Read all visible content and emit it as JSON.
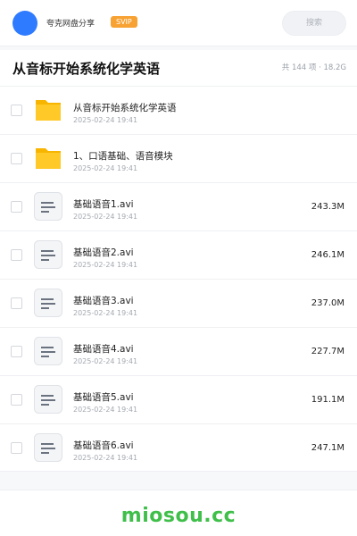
{
  "header": {
    "brand": "夸克网盘分享",
    "badge": "SVIP",
    "search_placeholder": "搜索",
    "accent": "#2f7bff"
  },
  "folder": {
    "title": "从音标开始系统化学英语",
    "meta": "共 144 项 · 18.2G"
  },
  "files": [
    {
      "icon": "folder-icon",
      "name": "从音标开始系统化学英语",
      "date": "2025-02-24 19:41",
      "size": ""
    },
    {
      "icon": "folder-icon",
      "name": "1、口语基础、语音模块",
      "date": "2025-02-24 19:41",
      "size": ""
    },
    {
      "icon": "file-icon",
      "name": "基础语音1.avi",
      "date": "2025-02-24 19:41",
      "size": "243.3M"
    },
    {
      "icon": "file-icon",
      "name": "基础语音2.avi",
      "date": "2025-02-24 19:41",
      "size": "246.1M"
    },
    {
      "icon": "file-icon",
      "name": "基础语音3.avi",
      "date": "2025-02-24 19:41",
      "size": "237.0M"
    },
    {
      "icon": "file-icon",
      "name": "基础语音4.avi",
      "date": "2025-02-24 19:41",
      "size": "227.7M"
    },
    {
      "icon": "file-icon",
      "name": "基础语音5.avi",
      "date": "2025-02-24 19:41",
      "size": "191.1M"
    },
    {
      "icon": "file-icon",
      "name": "基础语音6.avi",
      "date": "2025-02-24 19:41",
      "size": "247.1M"
    }
  ],
  "footer": {
    "watermark": "miosou.cc"
  }
}
